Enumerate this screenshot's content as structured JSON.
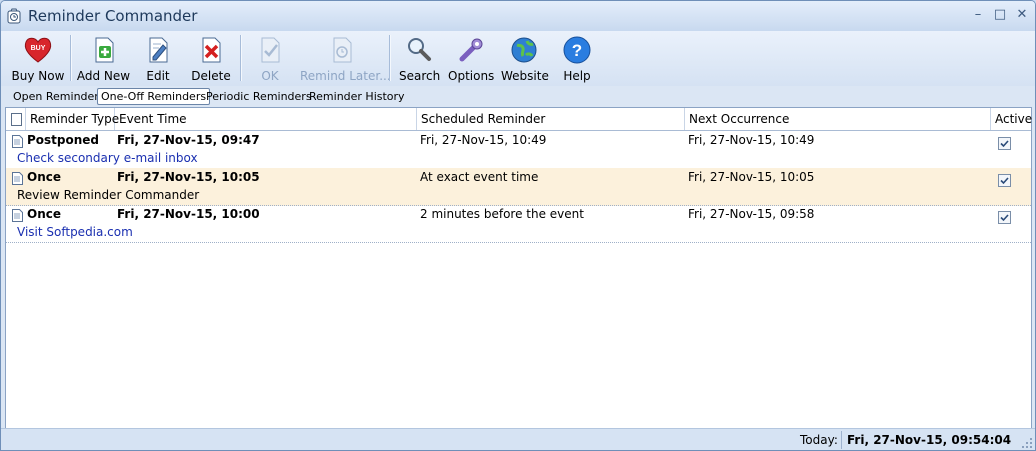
{
  "window": {
    "title": "Reminder Commander",
    "minimize": "–",
    "maximize": "□",
    "close": "✕"
  },
  "toolbar": {
    "buy_now": "Buy Now",
    "buy_badge": "BUY",
    "add_new": "Add New",
    "edit": "Edit",
    "delete": "Delete",
    "ok": "OK",
    "remind_later": "Remind Later...",
    "search": "Search",
    "options": "Options",
    "website": "Website",
    "help": "Help"
  },
  "tabs": [
    "Open Reminders",
    "One-Off Reminders",
    "Periodic Reminders",
    "Reminder History"
  ],
  "columns": {
    "type": "Reminder Type",
    "event_time": "Event Time",
    "scheduled": "Scheduled Reminder",
    "next": "Next Occurrence",
    "active": "Active"
  },
  "rows": [
    {
      "type": "Postponed",
      "event_time": "Fri, 27-Nov-15, 09:47",
      "scheduled": "Fri, 27-Nov-15, 10:49",
      "next": "Fri, 27-Nov-15, 10:49",
      "active": true,
      "description": "Check secondary e-mail inbox"
    },
    {
      "type": "Once",
      "event_time": "Fri, 27-Nov-15, 10:05",
      "scheduled": "At exact event time",
      "next": "Fri, 27-Nov-15, 10:05",
      "active": true,
      "description": "Review Reminder Commander"
    },
    {
      "type": "Once",
      "event_time": "Fri, 27-Nov-15, 10:00",
      "scheduled": "2 minutes before the event",
      "next": "Fri, 27-Nov-15, 09:58",
      "active": true,
      "description": "Visit Softpedia.com"
    }
  ],
  "status": {
    "label": "Today:",
    "value": "Fri, 27-Nov-15, 09:54:04"
  }
}
